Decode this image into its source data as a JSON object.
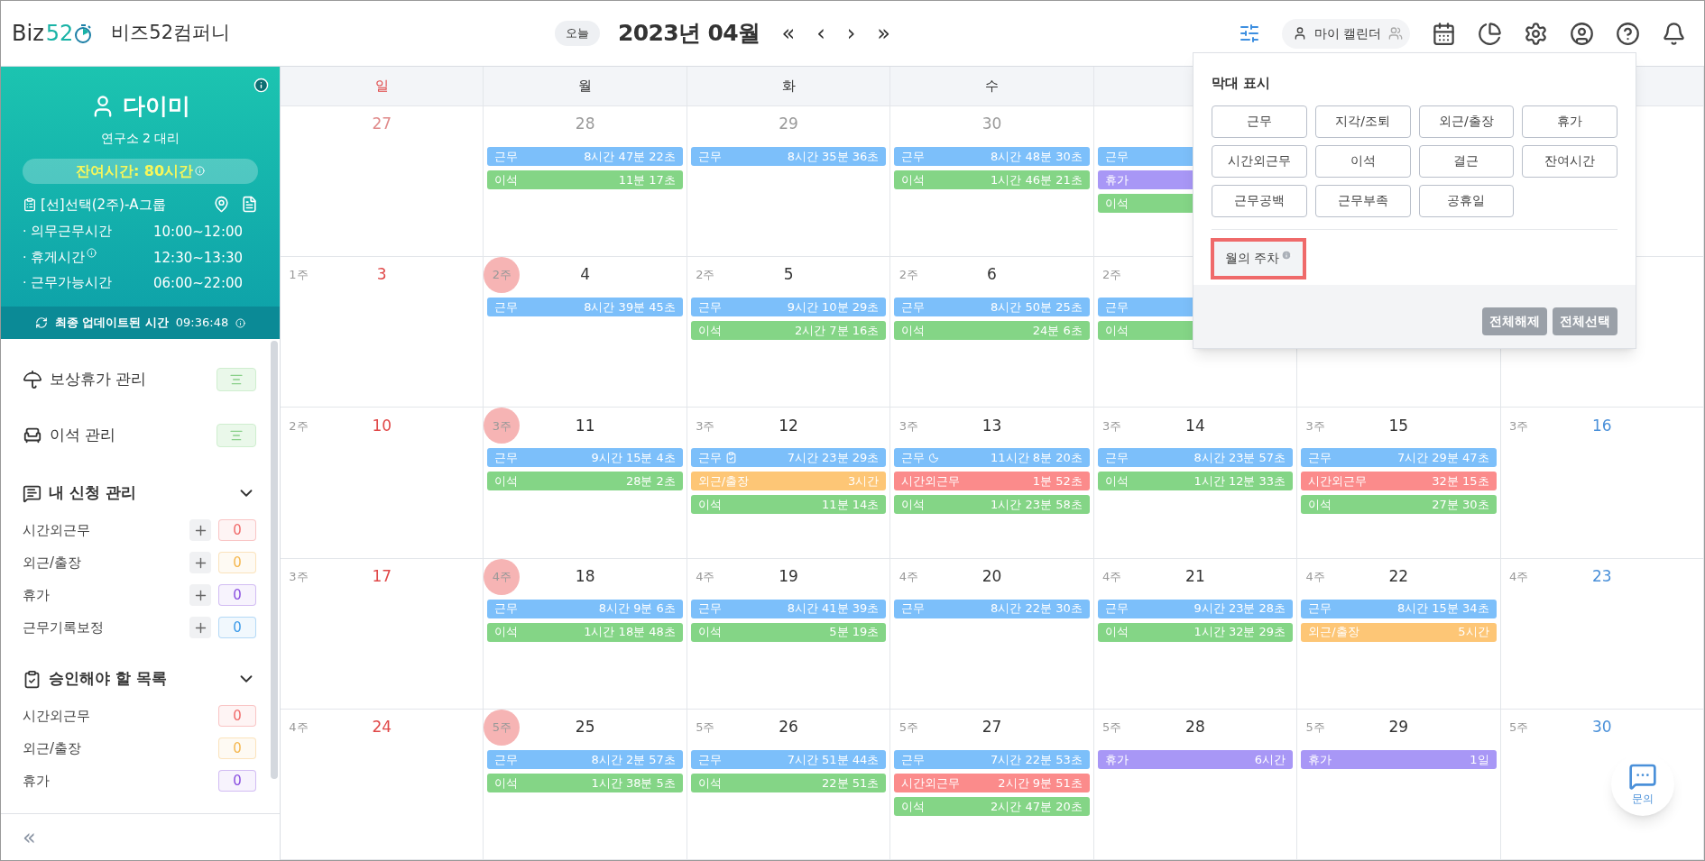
{
  "header": {
    "logo": [
      "Biz",
      "52"
    ],
    "company": "비즈52컴퍼니",
    "today_button": "오늘",
    "month": "2023년 04월",
    "nav": [
      "«",
      "‹",
      "›",
      "»"
    ],
    "calendar_toggle": {
      "label": "마이 캘린더"
    },
    "filter_active": true
  },
  "sidebar": {
    "profile": {
      "name": "다이미",
      "position": "연구소 2 대리",
      "remaining": "잔여시간: 80시간",
      "group": "[선]선택(2주)-A그룹",
      "schedule": [
        {
          "label": "· 의무근무시간",
          "time": "10:00~12:00",
          "info": false
        },
        {
          "label": "· 휴게시간",
          "time": "12:30~13:30",
          "info": true
        },
        {
          "label": "· 근무가능시간",
          "time": "06:00~22:00",
          "info": false
        }
      ],
      "updated": {
        "label": "최종 업데이트된 시간",
        "time": "09:36:48"
      }
    },
    "menus": [
      {
        "label": "보상휴가 관리"
      },
      {
        "label": "이석 관리"
      }
    ],
    "sections": [
      {
        "title": "내 신청 관리",
        "expanded": true,
        "items": [
          {
            "label": "시간외근무",
            "count": "0",
            "color": "#f06a6a",
            "addable": true
          },
          {
            "label": "외근/출장",
            "count": "0",
            "color": "#f5b74f",
            "addable": true
          },
          {
            "label": "휴가",
            "count": "0",
            "color": "#8a4fe0",
            "addable": true
          },
          {
            "label": "근무기록보정",
            "count": "0",
            "color": "#3d9be9",
            "addable": true
          }
        ]
      },
      {
        "title": "승인해야 할 목록",
        "expanded": true,
        "items": [
          {
            "label": "시간외근무",
            "count": "0",
            "color": "#f06a6a",
            "addable": false
          },
          {
            "label": "외근/출장",
            "count": "0",
            "color": "#f5b74f",
            "addable": false
          },
          {
            "label": "휴가",
            "count": "0",
            "color": "#8a4fe0",
            "addable": false
          }
        ]
      }
    ],
    "collapse": "«"
  },
  "calendar": {
    "weekdays": [
      {
        "label": "일"
      },
      {
        "label": "월"
      },
      {
        "label": "화"
      },
      {
        "label": "수"
      }
    ],
    "weeks": [
      {
        "days": [
          {
            "date": "27",
            "muted": true
          },
          {
            "date": "28",
            "muted": true,
            "events": [
              {
                "label": "근무",
                "value": "8시간 47분 22초",
                "color": "#7cbffa",
                "kind": "plain"
              },
              {
                "label": "이석",
                "value": "11분 17초",
                "color": "#84d586",
                "kind": "plain"
              }
            ]
          },
          {
            "date": "29",
            "muted": true,
            "events": [
              {
                "label": "근무",
                "value": "8시간 35분 36초",
                "color": "#7cbffa",
                "kind": "plain"
              }
            ]
          },
          {
            "date": "30",
            "muted": true,
            "events": [
              {
                "label": "근무",
                "value": "8시간 48분 30초",
                "color": "#7cbffa",
                "kind": "plain"
              },
              {
                "label": "이석",
                "value": "1시간 46분 21초",
                "color": "#84d586",
                "kind": "plain"
              }
            ]
          },
          {
            "events": [
              {
                "label": "근무",
                "color": "#7cbffa",
                "kind": "plain"
              },
              {
                "label": "휴가",
                "color": "#a897f6",
                "kind": "plain"
              },
              {
                "label": "이석",
                "color": "#84d586",
                "kind": "plain"
              }
            ]
          }
        ]
      },
      {
        "days": [
          {
            "week": "1주",
            "highlighted": false,
            "date": "3"
          },
          {
            "week": "2주",
            "highlighted": true,
            "date": "4",
            "events": [
              {
                "label": "근무",
                "value": "8시간 39분 45초",
                "color": "#7cbffa",
                "kind": "plain"
              }
            ]
          },
          {
            "week": "2주",
            "highlighted": false,
            "date": "5",
            "events": [
              {
                "label": "근무",
                "value": "9시간 10분 29초",
                "color": "#7cbffa",
                "kind": "plain"
              },
              {
                "label": "이석",
                "value": "2시간 7분 16초",
                "color": "#84d586",
                "kind": "plain"
              }
            ]
          },
          {
            "week": "2주",
            "highlighted": false,
            "date": "6",
            "events": [
              {
                "label": "근무",
                "value": "8시간 50분 25초",
                "color": "#7cbffa",
                "kind": "plain"
              },
              {
                "label": "이석",
                "value": "24분 6초",
                "color": "#84d586",
                "kind": "plain"
              }
            ]
          },
          {
            "week": "2주",
            "highlighted": false,
            "events": [
              {
                "label": "근무",
                "color": "#7cbffa",
                "kind": "plain"
              },
              {
                "label": "이석",
                "color": "#84d586",
                "kind": "plain"
              }
            ]
          }
        ]
      },
      {
        "days": [
          {
            "week": "2주",
            "highlighted": false,
            "date": "10"
          },
          {
            "week": "3주",
            "highlighted": true,
            "date": "11",
            "events": [
              {
                "label": "근무",
                "value": "9시간 15분 4초",
                "color": "#7cbffa",
                "kind": "plain"
              },
              {
                "label": "이석",
                "value": "28분 2초",
                "color": "#84d586",
                "kind": "plain"
              }
            ]
          },
          {
            "week": "3주",
            "highlighted": false,
            "date": "12",
            "events": [
              {
                "label": "근무",
                "value": "7시간 23분 29초",
                "color": "#7cbffa",
                "kind": "approved"
              },
              {
                "label": "외근/출장",
                "value": "3시간",
                "color": "#fdc676",
                "kind": "plain"
              },
              {
                "label": "이석",
                "value": "11분 14초",
                "color": "#84d586",
                "kind": "plain"
              }
            ]
          },
          {
            "week": "3주",
            "highlighted": false,
            "date": "13",
            "events": [
              {
                "label": "근무",
                "value": "11시간 8분 20초",
                "color": "#7cbffa",
                "kind": "night"
              },
              {
                "label": "시간외근무",
                "value": "1분 52초",
                "color": "#fb8b8b",
                "kind": "plain"
              },
              {
                "label": "이석",
                "value": "1시간 23분 58초",
                "color": "#84d586",
                "kind": "plain"
              }
            ]
          },
          {
            "week": "3주",
            "highlighted": false,
            "date": "14",
            "events": [
              {
                "label": "근무",
                "value": "8시간 23분 57초",
                "color": "#7cbffa",
                "kind": "plain"
              },
              {
                "label": "이석",
                "value": "1시간 12분 33초",
                "color": "#84d586",
                "kind": "plain"
              }
            ]
          },
          {
            "week": "3주",
            "highlighted": false,
            "date": "15",
            "events": [
              {
                "label": "근무",
                "value": "7시간 29분 47초",
                "color": "#7cbffa",
                "kind": "plain"
              },
              {
                "label": "시간외근무",
                "value": "32분 15초",
                "color": "#fb8b8b",
                "kind": "plain"
              },
              {
                "label": "이석",
                "value": "27분 30초",
                "color": "#84d586",
                "kind": "plain"
              }
            ]
          },
          {
            "week": "3주",
            "highlighted": false,
            "date": "16"
          }
        ]
      },
      {
        "days": [
          {
            "week": "3주",
            "highlighted": false,
            "date": "17"
          },
          {
            "week": "4주",
            "highlighted": true,
            "date": "18",
            "events": [
              {
                "label": "근무",
                "value": "8시간 9분 6초",
                "color": "#7cbffa",
                "kind": "plain"
              },
              {
                "label": "이석",
                "value": "1시간 18분 48초",
                "color": "#84d586",
                "kind": "plain"
              }
            ]
          },
          {
            "week": "4주",
            "highlighted": false,
            "date": "19",
            "events": [
              {
                "label": "근무",
                "value": "8시간 41분 39초",
                "color": "#7cbffa",
                "kind": "plain"
              },
              {
                "label": "이석",
                "value": "5분 19초",
                "color": "#84d586",
                "kind": "plain"
              }
            ]
          },
          {
            "week": "4주",
            "highlighted": false,
            "date": "20",
            "events": [
              {
                "label": "근무",
                "value": "8시간 22분 30초",
                "color": "#7cbffa",
                "kind": "plain"
              }
            ]
          },
          {
            "week": "4주",
            "highlighted": false,
            "date": "21",
            "events": [
              {
                "label": "근무",
                "value": "9시간 23분 28초",
                "color": "#7cbffa",
                "kind": "plain"
              },
              {
                "label": "이석",
                "value": "1시간 32분 29초",
                "color": "#84d586",
                "kind": "plain"
              }
            ]
          },
          {
            "week": "4주",
            "highlighted": false,
            "date": "22",
            "events": [
              {
                "label": "근무",
                "value": "8시간 15분 34초",
                "color": "#7cbffa",
                "kind": "plain"
              },
              {
                "label": "외근/출장",
                "value": "5시간",
                "color": "#fdc676",
                "kind": "plain"
              }
            ]
          },
          {
            "week": "4주",
            "highlighted": false,
            "date": "23"
          }
        ]
      },
      {
        "days": [
          {
            "week": "4주",
            "highlighted": false,
            "date": "24"
          },
          {
            "week": "5주",
            "highlighted": true,
            "date": "25",
            "events": [
              {
                "label": "근무",
                "value": "8시간 2분 57초",
                "color": "#7cbffa",
                "kind": "plain"
              },
              {
                "label": "이석",
                "value": "1시간 38분 5초",
                "color": "#84d586",
                "kind": "plain"
              }
            ]
          },
          {
            "week": "5주",
            "highlighted": false,
            "date": "26",
            "events": [
              {
                "label": "근무",
                "value": "7시간 51분 44초",
                "color": "#7cbffa",
                "kind": "plain"
              },
              {
                "label": "이석",
                "value": "22분 51초",
                "color": "#84d586",
                "kind": "plain"
              }
            ]
          },
          {
            "week": "5주",
            "highlighted": false,
            "date": "27",
            "events": [
              {
                "label": "근무",
                "value": "7시간 22분 53초",
                "color": "#7cbffa",
                "kind": "plain"
              },
              {
                "label": "시간외근무",
                "value": "2시간 9분 51초",
                "color": "#fb8b8b",
                "kind": "plain"
              },
              {
                "label": "이석",
                "value": "2시간 47분 20초",
                "color": "#84d586",
                "kind": "plain"
              }
            ]
          },
          {
            "week": "5주",
            "highlighted": false,
            "date": "28",
            "events": [
              {
                "label": "휴가",
                "value": "6시간",
                "color": "#a897f6",
                "kind": "plain"
              }
            ]
          },
          {
            "week": "5주",
            "highlighted": false,
            "date": "29",
            "events": [
              {
                "label": "휴가",
                "value": "1일",
                "color": "#a897f6",
                "kind": "plain"
              }
            ]
          },
          {
            "week": "5주",
            "highlighted": false,
            "date": "30"
          }
        ]
      }
    ]
  },
  "bar_display_popup": {
    "title": "막대 표시",
    "options": [
      "근무",
      "지각/조퇴",
      "외근/출장",
      "휴가",
      "시간외근무",
      "이석",
      "결근",
      "잔여시간",
      "근무공백",
      "근무부족",
      "공휴일"
    ],
    "week_option": {
      "label": "월의 주차",
      "highlighted": true
    },
    "buttons": [
      "전체해제",
      "전체선택"
    ]
  },
  "chat_button": {
    "label": "문의"
  }
}
